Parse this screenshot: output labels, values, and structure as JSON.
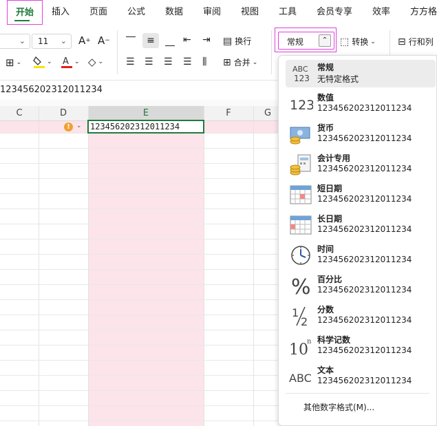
{
  "menu": {
    "tabs": [
      {
        "label": "开始",
        "active": true
      },
      {
        "label": "插入"
      },
      {
        "label": "页面"
      },
      {
        "label": "公式"
      },
      {
        "label": "数据"
      },
      {
        "label": "审阅"
      },
      {
        "label": "视图"
      },
      {
        "label": "工具"
      },
      {
        "label": "会员专享"
      },
      {
        "label": "效率"
      },
      {
        "label": "方方格"
      }
    ]
  },
  "ribbon": {
    "font_size": "11",
    "wrap_label": "换行",
    "merge_label": "合并",
    "number_format": "常规",
    "convert_label": "转换",
    "rowcol_label": "行和列"
  },
  "formula_bar": {
    "content": "123456202312011234"
  },
  "grid": {
    "columns": [
      "C",
      "D",
      "E",
      "F",
      "G"
    ],
    "selected_column": "E",
    "active_cell_value": "123456202312011234"
  },
  "format_menu": {
    "items": [
      {
        "name": "常规",
        "sample": "无特定格式",
        "icon": "abc-123-icon"
      },
      {
        "name": "数值",
        "sample": "123456202312011234",
        "icon": "number-123-icon"
      },
      {
        "name": "货币",
        "sample": "123456202312011234",
        "icon": "currency-icon"
      },
      {
        "name": "会计专用",
        "sample": " 123456202312011234",
        "icon": "accounting-icon"
      },
      {
        "name": "短日期",
        "sample": "123456202312011234",
        "icon": "calendar-short-icon"
      },
      {
        "name": "长日期",
        "sample": "123456202312011234",
        "icon": "calendar-long-icon"
      },
      {
        "name": "时间",
        "sample": "123456202312011234",
        "icon": "clock-icon"
      },
      {
        "name": "百分比",
        "sample": "123456202312011234",
        "icon": "percent-icon"
      },
      {
        "name": "分数",
        "sample": "123456202312011234",
        "icon": "fraction-icon"
      },
      {
        "name": "科学记数",
        "sample": "123456202312011234",
        "icon": "scientific-icon"
      },
      {
        "name": "文本",
        "sample": "123456202312011234",
        "icon": "text-abc-icon"
      }
    ],
    "more_label": "其他数字格式(M)..."
  },
  "colors": {
    "accent": "#1e7a3c",
    "highlight": "#e040e0",
    "column_fill": "#fce4ea"
  }
}
